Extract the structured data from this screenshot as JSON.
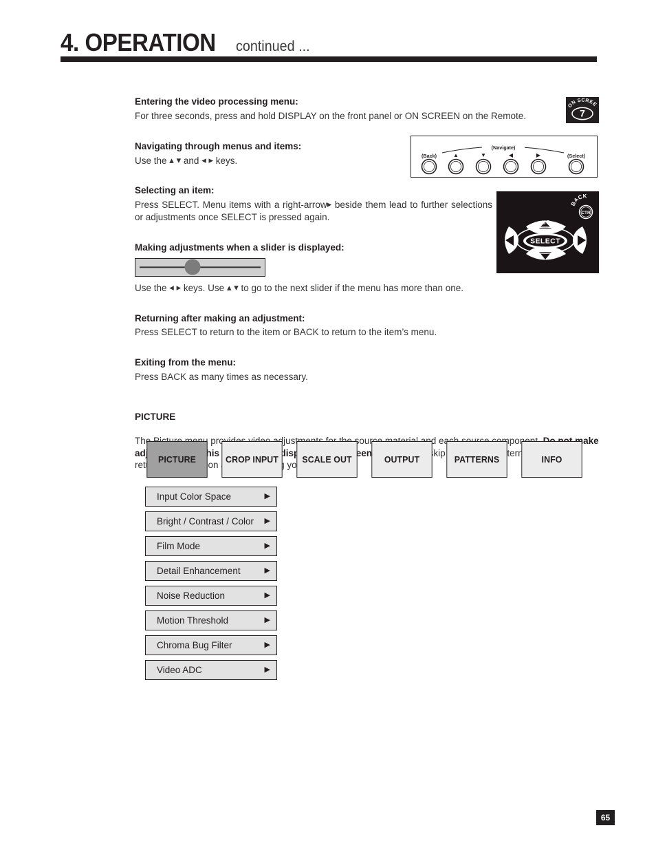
{
  "header": {
    "number_title": "4. OPERATION",
    "continued": "continued ..."
  },
  "sections": [
    {
      "title": "Entering the video processing menu:",
      "body": "For three seconds, press and hold DISPLAY on the front panel or ON SCREEN on the Remote."
    },
    {
      "title": "Navigating through menus and items:",
      "body_prefix": "Use the",
      "body_mid": "and",
      "body_suffix": "keys."
    },
    {
      "title": "Selecting an item:",
      "body_a": "Press SELECT. Menu items with a right-arrow",
      "body_b": "beside them lead to further selections or adjustments once SELECT is pressed again."
    },
    {
      "title": "Making adjustments when a slider is displayed:",
      "caption_a": "Use the",
      "caption_b": "keys. Use",
      "caption_c": "to go to the next slider if the menu has more than one."
    },
    {
      "title": "Returning after making an adjustment:",
      "body": "Press SELECT to return to the item or BACK to return to the item’s menu."
    },
    {
      "title": "Exiting from the menu:",
      "body": "Press BACK as many times as necessary."
    }
  ],
  "picture": {
    "heading": "PICTURE",
    "para_1": "The Picture menu provides video adjustments for the source material and each source component. ",
    "para_bold": "Do not make adjustments in this menu if your display has not been calibrated",
    "para_2": " – skip to the Test Patterns section and return to this section after calibrating your display."
  },
  "tabs": [
    {
      "label": "PICTURE",
      "active": true
    },
    {
      "label": "CROP INPUT",
      "active": false
    },
    {
      "label": "SCALE OUT",
      "active": false
    },
    {
      "label": "OUTPUT",
      "active": false
    },
    {
      "label": "PATTERNS",
      "active": false
    },
    {
      "label": "INFO",
      "active": false
    }
  ],
  "menu_items": [
    {
      "label": "Input Color Space",
      "arrow": "▶"
    },
    {
      "label": "Bright / Contrast / Color",
      "arrow": "▶"
    },
    {
      "label": "Film Mode",
      "arrow": "▶"
    },
    {
      "label": "Detail Enhancement",
      "arrow": "▶"
    },
    {
      "label": "Noise Reduction",
      "arrow": "▶"
    },
    {
      "label": "Motion Threshold",
      "arrow": "▶"
    },
    {
      "label": "Chroma Bug Filter",
      "arrow": "▶"
    },
    {
      "label": "Video ADC",
      "arrow": "▶"
    }
  ],
  "front_panel": {
    "label_back": "(Back)",
    "label_navigate": "(Navigate)",
    "label_select": "(Select)",
    "key_up": "▲",
    "key_down": "▼",
    "key_left": "◀",
    "key_right": "▶"
  },
  "remote": {
    "select_label": "SELECT",
    "status_label": "STATUS",
    "back_label": "BACK",
    "ctr_label": "CTR"
  },
  "onscreen_key": {
    "label": "ON SCREEN",
    "number": "7"
  },
  "footer": {
    "page_number": "65"
  },
  "colors": {
    "ink": "#231f20",
    "tab_inactive": "#ececec",
    "tab_active": "#a0a0a0",
    "menu_item_bg": "#e2e2e2",
    "slider_bg": "#cfcfcf",
    "slider_knob": "#7c7c7c",
    "remote_bg": "#1a1416"
  }
}
